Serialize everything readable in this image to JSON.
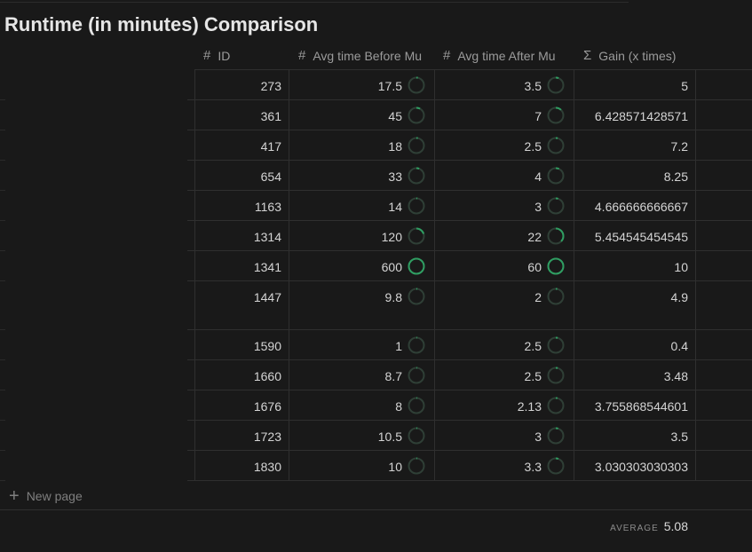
{
  "page": {
    "title": "Runtime (in minutes) Comparison"
  },
  "columns": [
    {
      "icon": "#",
      "label": "ID"
    },
    {
      "icon": "#",
      "label": "Avg time Before Mu"
    },
    {
      "icon": "#",
      "label": "Avg time After Mu"
    },
    {
      "icon": "Σ",
      "label": "Gain (x times)"
    }
  ],
  "rows": [
    {
      "id": "273",
      "before": "17.5",
      "before_progress": 0.03,
      "after": "3.5",
      "after_progress": 0.06,
      "gain": "5"
    },
    {
      "id": "361",
      "before": "45",
      "before_progress": 0.08,
      "after": "7",
      "after_progress": 0.12,
      "gain": "6.428571428571"
    },
    {
      "id": "417",
      "before": "18",
      "before_progress": 0.03,
      "after": "2.5",
      "after_progress": 0.04,
      "gain": "7.2"
    },
    {
      "id": "654",
      "before": "33",
      "before_progress": 0.06,
      "after": "4",
      "after_progress": 0.07,
      "gain": "8.25"
    },
    {
      "id": "1163",
      "before": "14",
      "before_progress": 0.02,
      "after": "3",
      "after_progress": 0.05,
      "gain": "4.666666666667"
    },
    {
      "id": "1314",
      "before": "120",
      "before_progress": 0.2,
      "after": "22",
      "after_progress": 0.37,
      "gain": "5.454545454545"
    },
    {
      "id": "1341",
      "before": "600",
      "before_progress": 1.0,
      "after": "60",
      "after_progress": 1.0,
      "gain": "10"
    },
    {
      "id": "1447",
      "before": "9.8",
      "before_progress": 0.02,
      "after": "2",
      "after_progress": 0.03,
      "gain": "4.9",
      "tall": true
    },
    {
      "id": "1590",
      "before": "1",
      "before_progress": 0.005,
      "after": "2.5",
      "after_progress": 0.04,
      "gain": "0.4"
    },
    {
      "id": "1660",
      "before": "8.7",
      "before_progress": 0.015,
      "after": "2.5",
      "after_progress": 0.04,
      "gain": "3.48"
    },
    {
      "id": "1676",
      "before": "8",
      "before_progress": 0.013,
      "after": "2.13",
      "after_progress": 0.035,
      "gain": "3.755868544601"
    },
    {
      "id": "1723",
      "before": "10.5",
      "before_progress": 0.018,
      "after": "3",
      "after_progress": 0.05,
      "gain": "3.5"
    },
    {
      "id": "1830",
      "before": "10",
      "before_progress": 0.017,
      "after": "3.3",
      "after_progress": 0.055,
      "gain": "3.030303030303"
    }
  ],
  "footer": {
    "new_page_icon": "+",
    "new_page_label": "New page",
    "average_label": "AVERAGE",
    "average_value": "5.08"
  },
  "colors": {
    "background": "#191919",
    "ring_track": "#2f3f36",
    "ring_fill": "#2f9e62",
    "text": "#d4d4d4",
    "muted": "#9b9b9b"
  }
}
